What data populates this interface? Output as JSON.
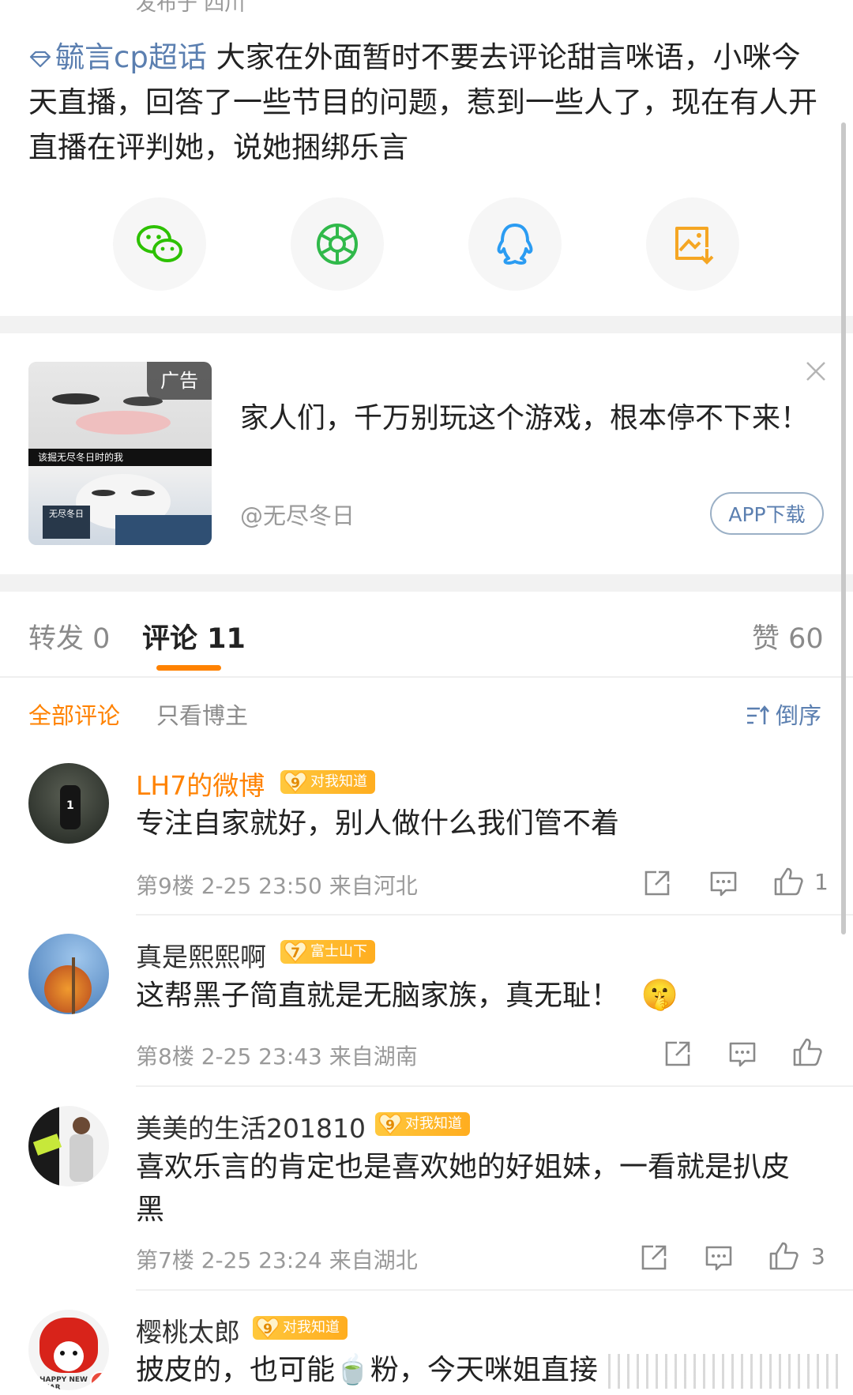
{
  "post": {
    "posted_from": "发布于 四川",
    "topic": "毓言cp超话",
    "text": " 大家在外面暂时不要去评论甜言咪语，小咪今天直播，回答了一些节目的问题，惹到一些人了，现在有人开直播在评判她，说她捆绑乐言"
  },
  "share": {
    "icons": [
      "wechat-icon",
      "moments-icon",
      "qq-icon",
      "save-image-icon"
    ],
    "colors": {
      "wechat": "#2dc100",
      "moments": "#30b94a",
      "qq": "#2b9cf2",
      "save": "#f5a623"
    }
  },
  "ad": {
    "tag": "广告",
    "title": "家人们，千万别玩这个游戏，根本停不下来！",
    "source": "@无尽冬日",
    "button": "APP下载",
    "caption": "该掘无尽冬日时的我",
    "sub_caption": "无尽冬日"
  },
  "tabs": {
    "repost": "转发 0",
    "comments": "评论 11",
    "likes": "赞 60"
  },
  "filters": {
    "all": "全部评论",
    "owner_only": "只看博主",
    "sort": "倒序"
  },
  "comments": [
    {
      "user": "LH7的微博",
      "user_color": "#ff8200",
      "badge_level": "9",
      "badge_text": "对我知道",
      "text": "专注自家就好，别人做什么我们管不着",
      "floor": "第9楼",
      "time": "2-25 23:50",
      "location": "来自河北",
      "likes": "1"
    },
    {
      "user": "真是熙熙啊",
      "user_color": "#333333",
      "badge_level": "7",
      "badge_text": "富士山下",
      "text": "这帮黑子简直就是无脑家族，真无耻！",
      "emoji": "🤫",
      "floor": "第8楼",
      "time": "2-25 23:43",
      "location": "来自湖南",
      "likes": ""
    },
    {
      "user": "美美的生活201810",
      "user_color": "#333333",
      "badge_level": "9",
      "badge_text": "对我知道",
      "text": "喜欢乐言的肯定也是喜欢她的好姐妹，一看就是扒皮黑",
      "floor": "第7楼",
      "time": "2-25 23:24",
      "location": "来自湖北",
      "likes": "3"
    },
    {
      "user": "樱桃太郎",
      "user_color": "#333333",
      "badge_level": "9",
      "badge_text": "对我知道",
      "text": "披皮的，也可能🍵粉，今天咪姐直接",
      "avatar_text": "HAPPY NEW YEAR"
    }
  ]
}
